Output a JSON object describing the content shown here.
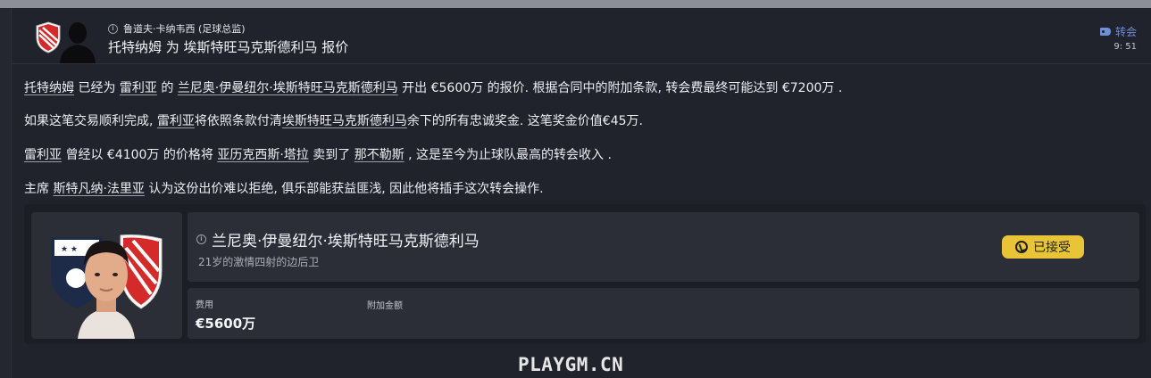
{
  "header": {
    "sender": "鲁道夫·卡纳韦西 (足球总监)",
    "subject": "托特纳姆 为 埃斯特旺马克斯德利马 报价",
    "tag_label": "转会",
    "time": "9: 51"
  },
  "body": {
    "p1": [
      {
        "text": "托特纳姆",
        "link": true
      },
      {
        "text": " 已经为 ",
        "link": false
      },
      {
        "text": "雷利亚",
        "link": true
      },
      {
        "text": " 的 ",
        "link": false
      },
      {
        "text": "兰尼奥·伊曼纽尔·埃斯特旺马克斯德利马",
        "link": true
      },
      {
        "text": " 开出 €5600万 的报价. 根据合同中的附加条款, 转会费最终可能达到 €7200万 .",
        "link": false
      }
    ],
    "p2": [
      {
        "text": "如果这笔交易顺利完成, ",
        "link": false
      },
      {
        "text": "雷利亚",
        "link": true
      },
      {
        "text": "将依照条款付清",
        "link": false
      },
      {
        "text": "埃斯特旺马克斯德利马",
        "link": true
      },
      {
        "text": "余下的所有忠诚奖金. 这笔奖金价值€45万.",
        "link": false
      }
    ],
    "p3": [
      {
        "text": "雷利亚",
        "link": true
      },
      {
        "text": " 曾经以 €4100万 的价格将 ",
        "link": false
      },
      {
        "text": "亚历克西斯·塔拉",
        "link": true
      },
      {
        "text": " 卖到了 ",
        "link": false
      },
      {
        "text": "那不勒斯",
        "link": true
      },
      {
        "text": " , 这是至今为止球队最高的转会收入 .",
        "link": false
      }
    ],
    "p4": [
      {
        "text": "主席 ",
        "link": false
      },
      {
        "text": "斯特凡纳·法里亚",
        "link": true
      },
      {
        "text": " 认为这份出价难以拒绝, 俱乐部能获益匪浅, 因此他将插手这次转会操作.",
        "link": false
      }
    ]
  },
  "card": {
    "player_name": "兰尼奥·伊曼纽尔·埃斯特旺马克斯德利马",
    "player_desc": "21岁的激情四射的边后卫",
    "status": "已接受",
    "fee_label": "费用",
    "fee_value": "€5600万",
    "addon_label": "附加金额"
  },
  "watermark": "PLAYGM.CN",
  "colors": {
    "background": "#20232b",
    "accent_blue": "#6f8fd6",
    "status_yellow": "#e8c436",
    "club_red": "#d42a2a"
  },
  "icons": [
    "info-icon",
    "transfer-tag-icon",
    "accepted-icon",
    "club-badge-icon",
    "staff-silhouette-icon"
  ]
}
